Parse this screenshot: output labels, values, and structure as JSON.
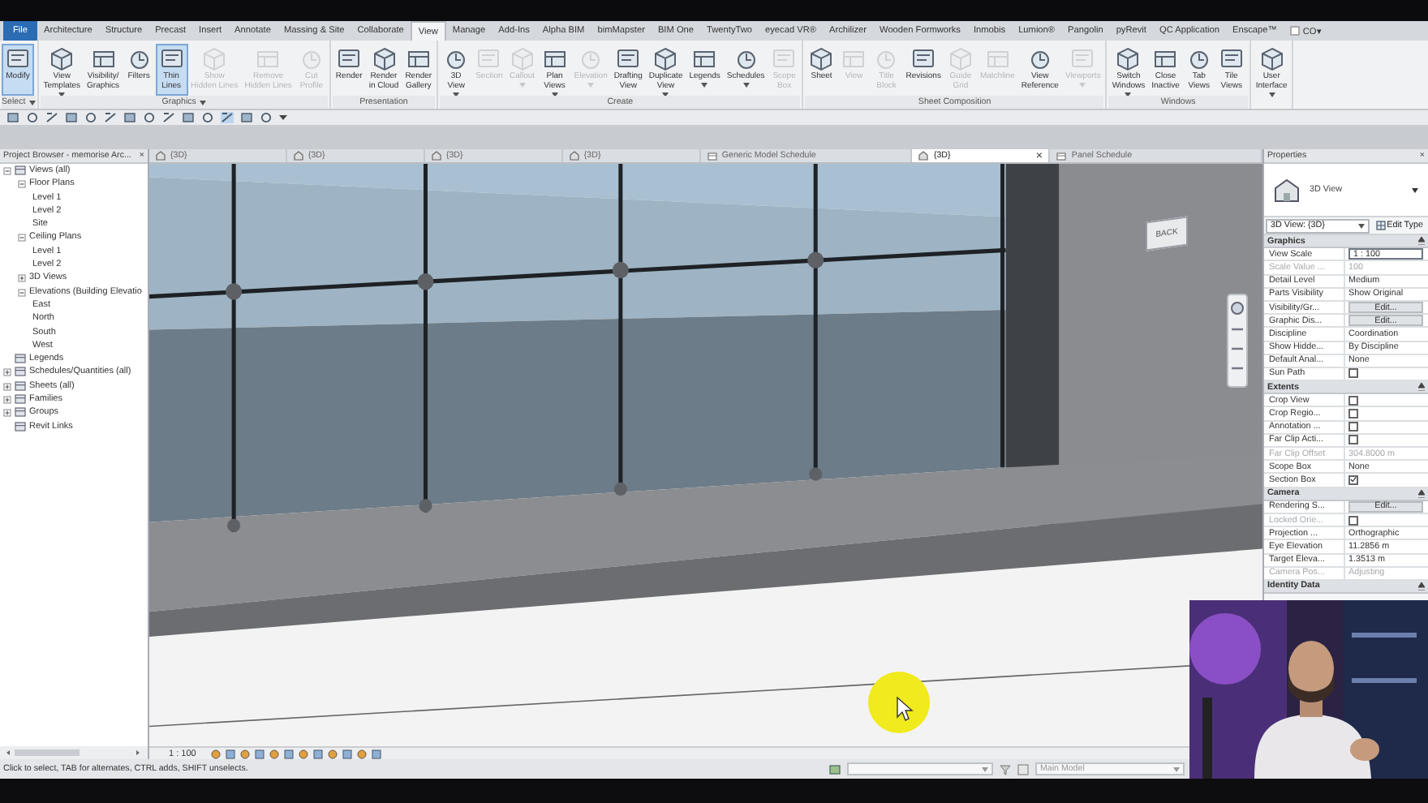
{
  "ribbon_tabs": [
    {
      "label": "File",
      "kind": "file",
      "selected": false
    },
    {
      "label": "Architecture",
      "kind": "tab",
      "selected": false
    },
    {
      "label": "Structure",
      "kind": "tab",
      "selected": false
    },
    {
      "label": "Precast",
      "kind": "tab",
      "selected": false
    },
    {
      "label": "Insert",
      "kind": "tab",
      "selected": false
    },
    {
      "label": "Annotate",
      "kind": "tab",
      "selected": false
    },
    {
      "label": "Massing & Site",
      "kind": "tab",
      "selected": false
    },
    {
      "label": "Collaborate",
      "kind": "tab",
      "selected": false
    },
    {
      "label": "View",
      "kind": "tab",
      "selected": true
    },
    {
      "label": "Manage",
      "kind": "tab",
      "selected": false
    },
    {
      "label": "Add-Ins",
      "kind": "tab",
      "selected": false
    },
    {
      "label": "Alpha BIM",
      "kind": "tab",
      "selected": false
    },
    {
      "label": "bimMapster",
      "kind": "tab",
      "selected": false
    },
    {
      "label": "BIM One",
      "kind": "tab",
      "selected": false
    },
    {
      "label": "TwentyTwo",
      "kind": "tab",
      "selected": false
    },
    {
      "label": "eyecad VR®",
      "kind": "tab",
      "selected": false
    },
    {
      "label": "Archilizer",
      "kind": "tab",
      "selected": false
    },
    {
      "label": "Wooden Formworks",
      "kind": "tab",
      "selected": false
    },
    {
      "label": "Inmobis",
      "kind": "tab",
      "selected": false
    },
    {
      "label": "Lumion®",
      "kind": "tab",
      "selected": false
    },
    {
      "label": "Pangolin",
      "kind": "tab",
      "selected": false
    },
    {
      "label": "pyRevit",
      "kind": "tab",
      "selected": false
    },
    {
      "label": "QC Application",
      "kind": "tab",
      "selected": false
    },
    {
      "label": "Enscape™",
      "kind": "tab",
      "selected": false
    },
    {
      "label": "CO▾",
      "kind": "menu",
      "selected": false
    }
  ],
  "ribbon_panels": [
    {
      "label": "Select",
      "dropdown": true,
      "buttons": [
        {
          "label": "Modify",
          "selected": true,
          "disabled": false,
          "dropdown": false
        }
      ]
    },
    {
      "label": "Graphics",
      "dropdown": true,
      "buttons": [
        {
          "label": "View\nTemplates",
          "selected": false,
          "disabled": false,
          "dropdown": true
        },
        {
          "label": "Visibility/\nGraphics",
          "selected": false,
          "disabled": false,
          "dropdown": false
        },
        {
          "label": "Filters",
          "selected": false,
          "disabled": false,
          "dropdown": false
        },
        {
          "label": "Thin\nLines",
          "selected": true,
          "disabled": false,
          "dropdown": false
        },
        {
          "label": "Show\nHidden Lines",
          "selected": false,
          "disabled": true,
          "dropdown": false
        },
        {
          "label": "Remove\nHidden Lines",
          "selected": false,
          "disabled": true,
          "dropdown": false
        },
        {
          "label": "Cut\nProfile",
          "selected": false,
          "disabled": true,
          "dropdown": false
        }
      ]
    },
    {
      "label": "Presentation",
      "dropdown": false,
      "buttons": [
        {
          "label": "Render",
          "selected": false,
          "disabled": false,
          "dropdown": false
        },
        {
          "label": "Render\nin Cloud",
          "selected": false,
          "disabled": false,
          "dropdown": false
        },
        {
          "label": "Render\nGallery",
          "selected": false,
          "disabled": false,
          "dropdown": false
        }
      ]
    },
    {
      "label": "Create",
      "dropdown": false,
      "buttons": [
        {
          "label": "3D\nView",
          "selected": false,
          "disabled": false,
          "dropdown": true
        },
        {
          "label": "Section",
          "selected": false,
          "disabled": true,
          "dropdown": false
        },
        {
          "label": "Callout",
          "selected": false,
          "disabled": true,
          "dropdown": true
        },
        {
          "label": "Plan\nViews",
          "selected": false,
          "disabled": false,
          "dropdown": true
        },
        {
          "label": "Elevation",
          "selected": false,
          "disabled": true,
          "dropdown": true
        },
        {
          "label": "Drafting\nView",
          "selected": false,
          "disabled": false,
          "dropdown": false
        },
        {
          "label": "Duplicate\nView",
          "selected": false,
          "disabled": false,
          "dropdown": true
        },
        {
          "label": "Legends",
          "selected": false,
          "disabled": false,
          "dropdown": true
        },
        {
          "label": "Schedules",
          "selected": false,
          "disabled": false,
          "dropdown": true
        },
        {
          "label": "Scope\nBox",
          "selected": false,
          "disabled": true,
          "dropdown": false
        }
      ]
    },
    {
      "label": "Sheet Composition",
      "dropdown": false,
      "buttons": [
        {
          "label": "Sheet",
          "selected": false,
          "disabled": false,
          "dropdown": false
        },
        {
          "label": "View",
          "selected": false,
          "disabled": true,
          "dropdown": false
        },
        {
          "label": "Title\nBlock",
          "selected": false,
          "disabled": true,
          "dropdown": false
        },
        {
          "label": "Revisions",
          "selected": false,
          "disabled": false,
          "dropdown": false
        },
        {
          "label": "Guide\nGrid",
          "selected": false,
          "disabled": true,
          "dropdown": false
        },
        {
          "label": "Matchline",
          "selected": false,
          "disabled": true,
          "dropdown": false
        },
        {
          "label": "View\nReference",
          "selected": false,
          "disabled": false,
          "dropdown": false
        },
        {
          "label": "Viewports",
          "selected": false,
          "disabled": true,
          "dropdown": true
        }
      ]
    },
    {
      "label": "Windows",
      "dropdown": false,
      "buttons": [
        {
          "label": "Switch\nWindows",
          "selected": false,
          "disabled": false,
          "dropdown": true
        },
        {
          "label": "Close\nInactive",
          "selected": false,
          "disabled": false,
          "dropdown": false
        },
        {
          "label": "Tab\nViews",
          "selected": false,
          "disabled": false,
          "dropdown": false
        },
        {
          "label": "Tile\nViews",
          "selected": false,
          "disabled": false,
          "dropdown": false
        }
      ]
    },
    {
      "buttons": [
        {
          "label": "User\nInterface",
          "selected": false,
          "disabled": false,
          "dropdown": true
        }
      ]
    }
  ],
  "project_browser": {
    "title": "Project Browser - memorise Arc...",
    "close": "×",
    "tree": [
      {
        "label": "Views (all)",
        "expanded": true,
        "children": [
          {
            "label": "Floor Plans",
            "expanded": true,
            "children": [
              {
                "label": "Level 1"
              },
              {
                "label": "Level 2"
              },
              {
                "label": "Site"
              }
            ]
          },
          {
            "label": "Ceiling Plans",
            "expanded": true,
            "children": [
              {
                "label": "Level 1"
              },
              {
                "label": "Level 2"
              }
            ]
          },
          {
            "label": "3D Views",
            "expanded": false
          },
          {
            "label": "Elevations (Building Elevatio",
            "expanded": true,
            "children": [
              {
                "label": "East"
              },
              {
                "label": "North"
              },
              {
                "label": "South"
              },
              {
                "label": "West"
              }
            ]
          }
        ]
      },
      {
        "label": "Legends"
      },
      {
        "label": "Schedules/Quantities (all)",
        "expanded": false
      },
      {
        "label": "Sheets (all)",
        "expanded": false
      },
      {
        "label": "Families",
        "expanded": false
      },
      {
        "label": "Groups",
        "expanded": false
      },
      {
        "label": "Revit Links"
      }
    ]
  },
  "view_tabs": [
    {
      "label": "{3D}",
      "kind": "view",
      "selected": false
    },
    {
      "label": "{3D}",
      "kind": "view",
      "selected": false
    },
    {
      "label": "{3D}",
      "kind": "view",
      "selected": false
    },
    {
      "label": "{3D}",
      "kind": "view",
      "selected": false
    },
    {
      "label": "Generic Model Schedule",
      "kind": "schedule",
      "selected": false
    },
    {
      "label": "{3D}",
      "kind": "view",
      "selected": true,
      "close": "×"
    },
    {
      "label": "Panel Schedule",
      "kind": "schedule",
      "selected": false
    }
  ],
  "viewport": {
    "view_cube": "BACK",
    "scale": "1 : 100"
  },
  "properties": {
    "title": "Properties",
    "close": "×",
    "type_name": "3D View",
    "selector": "3D View: {3D}",
    "edit_type": "Edit Type",
    "sections": [
      {
        "label": "Graphics",
        "rows": [
          {
            "name": "View Scale",
            "kind": "field",
            "value": "1 : 100",
            "disabled": false
          },
          {
            "name": "Scale Value ...",
            "kind": "text",
            "value": "100",
            "disabled": true
          },
          {
            "name": "Detail Level",
            "kind": "text",
            "value": "Medium",
            "disabled": false
          },
          {
            "name": "Parts Visibility",
            "kind": "text",
            "value": "Show Original",
            "disabled": false
          },
          {
            "name": "Visibility/Gr...",
            "kind": "button",
            "value": "Edit...",
            "disabled": false
          },
          {
            "name": "Graphic Dis...",
            "kind": "button",
            "value": "Edit...",
            "disabled": false
          },
          {
            "name": "Discipline",
            "kind": "text",
            "value": "Coordination",
            "disabled": false
          },
          {
            "name": "Show Hidde...",
            "kind": "text",
            "value": "By Discipline",
            "disabled": false
          },
          {
            "name": "Default Anal...",
            "kind": "text",
            "value": "None",
            "disabled": false
          },
          {
            "name": "Sun Path",
            "kind": "checkbox",
            "checked": false,
            "disabled": false
          }
        ]
      },
      {
        "label": "Extents",
        "rows": [
          {
            "name": "Crop View",
            "kind": "checkbox",
            "checked": false,
            "disabled": false
          },
          {
            "name": "Crop Regio...",
            "kind": "checkbox",
            "checked": false,
            "disabled": false
          },
          {
            "name": "Annotation ...",
            "kind": "checkbox",
            "checked": false,
            "disabled": false
          },
          {
            "name": "Far Clip Acti...",
            "kind": "checkbox",
            "checked": false,
            "disabled": false
          },
          {
            "name": "Far Clip Offset",
            "kind": "text",
            "value": "304.8000 m",
            "disabled": true
          },
          {
            "name": "Scope Box",
            "kind": "text",
            "value": "None",
            "disabled": false
          },
          {
            "name": "Section Box",
            "kind": "checkbox",
            "checked": true,
            "disabled": false
          }
        ]
      },
      {
        "label": "Camera",
        "rows": [
          {
            "name": "Rendering S...",
            "kind": "button",
            "value": "Edit...",
            "disabled": false
          },
          {
            "name": "Locked Orie...",
            "kind": "checkbox",
            "checked": false,
            "disabled": true
          },
          {
            "name": "Projection ...",
            "kind": "text",
            "value": "Orthographic",
            "disabled": false
          },
          {
            "name": "Eye Elevation",
            "kind": "text",
            "value": "11.2856 m",
            "disabled": false
          },
          {
            "name": "Target Eleva...",
            "kind": "text",
            "value": "1.3513 m",
            "disabled": false
          },
          {
            "name": "Camera Pos...",
            "kind": "text",
            "value": "Adjusting",
            "disabled": true
          }
        ]
      },
      {
        "label": "Identity Data"
      }
    ]
  },
  "status_bar": {
    "message": "Click to select, TAB for alternates, CTRL adds, SHIFT unselects.",
    "model": "Main Model"
  }
}
